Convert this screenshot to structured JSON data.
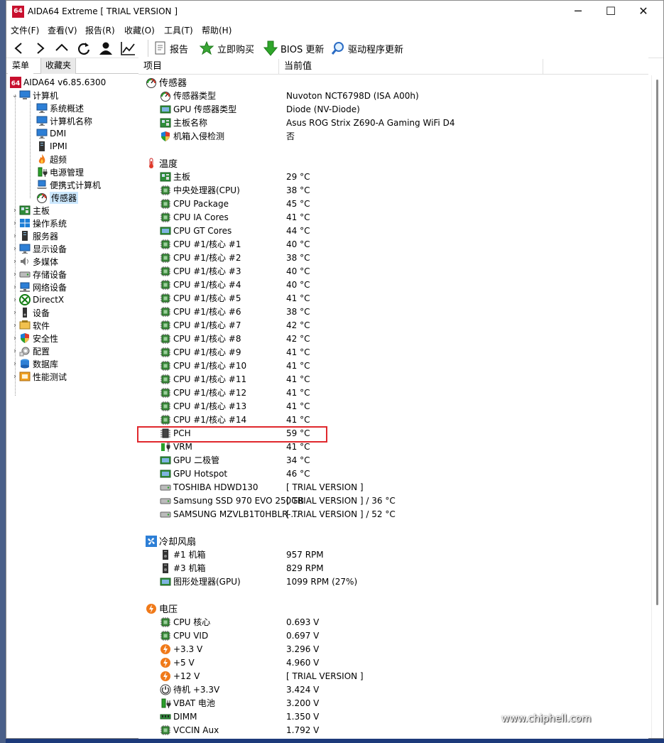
{
  "window": {
    "logo": "64",
    "title": "AIDA64 Extreme  [ TRIAL VERSION ]",
    "minimize": "─",
    "maximize": "☐",
    "close": "✕"
  },
  "menu": [
    "文件(F)",
    "查看(V)",
    "报告(R)",
    "收藏(O)",
    "工具(T)",
    "帮助(H)"
  ],
  "toolbar": {
    "report": "报告",
    "buy": "立即购买",
    "bios": "BIOS 更新",
    "driver": "驱动程序更新"
  },
  "panel_tabs": [
    "菜单",
    "收藏夹"
  ],
  "tree": {
    "root": "AIDA64 v6.85.6300",
    "computer": "计算机",
    "computer_children": [
      {
        "label": "系统概述",
        "icon": "monitor-icon"
      },
      {
        "label": "计算机名称",
        "icon": "monitor-icon"
      },
      {
        "label": "DMI",
        "icon": "monitor-icon"
      },
      {
        "label": "IPMI",
        "icon": "server-icon"
      },
      {
        "label": "超频",
        "icon": "flame-icon"
      },
      {
        "label": "电源管理",
        "icon": "battery-plug-icon"
      },
      {
        "label": "便携式计算机",
        "icon": "laptop-icon"
      },
      {
        "label": "传感器",
        "icon": "gauge-icon"
      }
    ],
    "top_items": [
      {
        "label": "主板",
        "icon": "motherboard-icon"
      },
      {
        "label": "操作系统",
        "icon": "windows-icon"
      },
      {
        "label": "服务器",
        "icon": "server-icon"
      },
      {
        "label": "显示设备",
        "icon": "monitor-icon"
      },
      {
        "label": "多媒体",
        "icon": "speaker-icon"
      },
      {
        "label": "存储设备",
        "icon": "disk-icon"
      },
      {
        "label": "网络设备",
        "icon": "network-icon"
      },
      {
        "label": "DirectX",
        "icon": "xbox-icon"
      },
      {
        "label": "设备",
        "icon": "device-icon"
      },
      {
        "label": "软件",
        "icon": "software-icon"
      },
      {
        "label": "安全性",
        "icon": "shield-icon"
      },
      {
        "label": "配置",
        "icon": "config-icon"
      },
      {
        "label": "数据库",
        "icon": "database-icon"
      },
      {
        "label": "性能测试",
        "icon": "benchmark-icon"
      }
    ]
  },
  "columns": {
    "item": "项目",
    "value": "当前值"
  },
  "groups": {
    "sensor": "传感器",
    "temperature": "温度",
    "fans": "冷却风扇",
    "voltage": "电压"
  },
  "sensor_rows": [
    {
      "name": "传感器类型",
      "value": "Nuvoton NCT6798D  (ISA A00h)",
      "icon": "gauge-icon"
    },
    {
      "name": "GPU 传感器类型",
      "value": "Diode  (NV-Diode)",
      "icon": "gpu-icon"
    },
    {
      "name": "主板名称",
      "value": "Asus ROG Strix Z690-A Gaming WiFi D4",
      "icon": "motherboard-icon"
    },
    {
      "name": "机箱入侵检测",
      "value": "否",
      "icon": "shield-icon"
    }
  ],
  "temperature_rows": [
    {
      "name": "主板",
      "value": "29 °C",
      "icon": "motherboard-icon"
    },
    {
      "name": "中央处理器(CPU)",
      "value": "38 °C",
      "icon": "chip-icon"
    },
    {
      "name": "CPU Package",
      "value": "45 °C",
      "icon": "chip-icon"
    },
    {
      "name": "CPU IA Cores",
      "value": "41 °C",
      "icon": "chip-icon"
    },
    {
      "name": "CPU GT Cores",
      "value": "44 °C",
      "icon": "gpu-icon"
    },
    {
      "name": "CPU #1/核心 #1",
      "value": "40 °C",
      "icon": "chip-icon"
    },
    {
      "name": "CPU #1/核心 #2",
      "value": "38 °C",
      "icon": "chip-icon"
    },
    {
      "name": "CPU #1/核心 #3",
      "value": "40 °C",
      "icon": "chip-icon"
    },
    {
      "name": "CPU #1/核心 #4",
      "value": "40 °C",
      "icon": "chip-icon"
    },
    {
      "name": "CPU #1/核心 #5",
      "value": "41 °C",
      "icon": "chip-icon"
    },
    {
      "name": "CPU #1/核心 #6",
      "value": "38 °C",
      "icon": "chip-icon"
    },
    {
      "name": "CPU #1/核心 #7",
      "value": "42 °C",
      "icon": "chip-icon"
    },
    {
      "name": "CPU #1/核心 #8",
      "value": "42 °C",
      "icon": "chip-icon"
    },
    {
      "name": "CPU #1/核心 #9",
      "value": "41 °C",
      "icon": "chip-icon"
    },
    {
      "name": "CPU #1/核心 #10",
      "value": "41 °C",
      "icon": "chip-icon"
    },
    {
      "name": "CPU #1/核心 #11",
      "value": "41 °C",
      "icon": "chip-icon"
    },
    {
      "name": "CPU #1/核心 #12",
      "value": "41 °C",
      "icon": "chip-icon"
    },
    {
      "name": "CPU #1/核心 #13",
      "value": "41 °C",
      "icon": "chip-icon"
    },
    {
      "name": "CPU #1/核心 #14",
      "value": "41 °C",
      "icon": "chip-icon"
    },
    {
      "name": "PCH",
      "value": "59 °C",
      "icon": "pch-chip-icon"
    },
    {
      "name": "VRM",
      "value": "41 °C",
      "icon": "vrm-icon"
    },
    {
      "name": "GPU 二极管",
      "value": "34 °C",
      "icon": "gpu-icon"
    },
    {
      "name": "GPU Hotspot",
      "value": "46 °C",
      "icon": "gpu-icon"
    },
    {
      "name": "TOSHIBA HDWD130",
      "value": "[ TRIAL VERSION ]",
      "icon": "disk-icon"
    },
    {
      "name": "Samsung SSD 970 EVO 250GB",
      "value": "[ TRIAL VERSION ] / 36 °C",
      "icon": "disk-icon"
    },
    {
      "name": "SAMSUNG MZVLB1T0HBLR-...",
      "value": "[ TRIAL VERSION ] / 52 °C",
      "icon": "disk-icon"
    }
  ],
  "fan_rows": [
    {
      "name": "#1 机箱",
      "value": "957 RPM",
      "icon": "case-icon"
    },
    {
      "name": "#3 机箱",
      "value": "829 RPM",
      "icon": "case-icon"
    },
    {
      "name": "图形处理器(GPU)",
      "value": "1099 RPM  (27%)",
      "icon": "gpu-icon"
    }
  ],
  "voltage_rows": [
    {
      "name": "CPU 核心",
      "value": "0.693 V",
      "icon": "chip-icon"
    },
    {
      "name": "CPU VID",
      "value": "0.697 V",
      "icon": "chip-icon"
    },
    {
      "name": "+3.3 V",
      "value": "3.296 V",
      "icon": "voltage-icon"
    },
    {
      "name": "+5 V",
      "value": "4.960 V",
      "icon": "voltage-icon"
    },
    {
      "name": "+12 V",
      "value": "[ TRIAL VERSION ]",
      "icon": "voltage-icon"
    },
    {
      "name": "待机 +3.3V",
      "value": "3.424 V",
      "icon": "standby-icon"
    },
    {
      "name": "VBAT 电池",
      "value": "3.200 V",
      "icon": "battery-plug-icon"
    },
    {
      "name": "DIMM",
      "value": "1.350 V",
      "icon": "dimm-icon"
    },
    {
      "name": "VCCIN Aux",
      "value": "1.792 V",
      "icon": "chip-icon"
    }
  ],
  "highlight": {
    "color": "#e0282d"
  },
  "watermark": "www.chiphell.com"
}
